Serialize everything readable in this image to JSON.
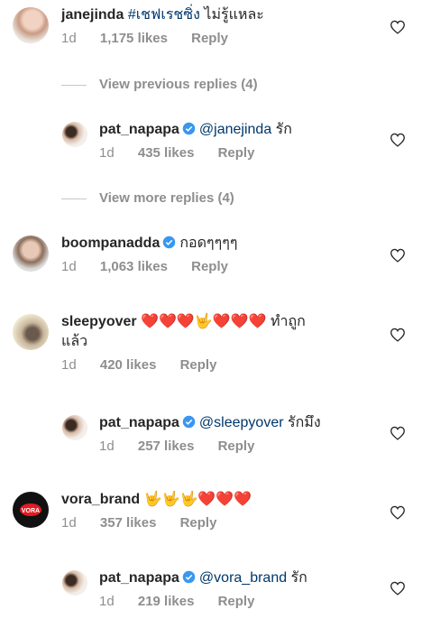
{
  "comments": [
    {
      "username": "janejinda",
      "hashtag": "#เชฟเรชซิ่ง",
      "text": " ไม่รู้แหละ",
      "time": "1d",
      "likes": "1,175 likes",
      "reply": "Reply"
    },
    {
      "username": "pat_napapa",
      "mention": "@janejinda",
      "text": " รัก",
      "time": "1d",
      "likes": "435 likes",
      "reply": "Reply"
    },
    {
      "username": "boompanadda",
      "text": "กอดๆๆๆๆ",
      "time": "1d",
      "likes": "1,063 likes",
      "reply": "Reply"
    },
    {
      "username": "sleepyover",
      "emojis": "❤️❤️❤️🤟❤️❤️❤️",
      "text_line1": " ทำถูก",
      "text_line2": "แล้ว",
      "time": "1d",
      "likes": "420 likes",
      "reply": "Reply"
    },
    {
      "username": "pat_napapa",
      "mention": "@sleepyover",
      "text": " รักมึง",
      "time": "1d",
      "likes": "257 likes",
      "reply": "Reply"
    },
    {
      "username": "vora_brand",
      "emojis": "🤟🤟🤟❤️❤️❤️",
      "time": "1d",
      "likes": "357 likes",
      "reply": "Reply"
    },
    {
      "username": "pat_napapa",
      "mention": "@vora_brand",
      "text": " รัก",
      "time": "1d",
      "likes": "219 likes",
      "reply": "Reply"
    }
  ],
  "view_previous": "View previous replies (4)",
  "view_more": "View more replies (4)",
  "vora_logo_text": "VORA",
  "colors": {
    "link": "#00376b",
    "meta": "#8e8e8e",
    "verified": "#3897f0",
    "heart": "#e0245e"
  }
}
